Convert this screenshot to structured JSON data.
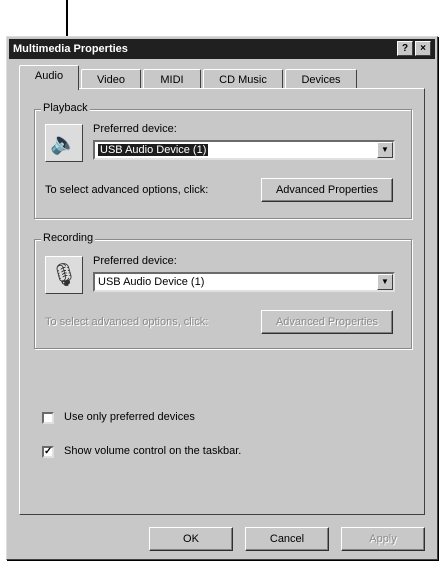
{
  "window": {
    "title": "Multimedia Properties",
    "help_btn": "?",
    "close_btn": "×"
  },
  "tabs": [
    {
      "label": "Audio"
    },
    {
      "label": "Video"
    },
    {
      "label": "MIDI"
    },
    {
      "label": "CD Music"
    },
    {
      "label": "Devices"
    }
  ],
  "playback": {
    "group_title": "Playback",
    "icon": "speaker-device-icon",
    "preferred_label": "Preferred device:",
    "device_value": "USB Audio Device (1)",
    "advanced_text": "To select advanced options, click:",
    "advanced_button": "Advanced Properties"
  },
  "recording": {
    "group_title": "Recording",
    "icon": "microphone-device-icon",
    "preferred_label": "Preferred device:",
    "device_value": "USB Audio Device (1)",
    "advanced_text": "To select advanced options, click:",
    "advanced_button": "Advanced Properties"
  },
  "options": {
    "use_preferred_label": "Use only preferred devices",
    "use_preferred_checked": false,
    "show_volume_label": "Show volume control on the taskbar.",
    "show_volume_checked": true
  },
  "footer": {
    "ok": "OK",
    "cancel": "Cancel",
    "apply": "Apply"
  }
}
